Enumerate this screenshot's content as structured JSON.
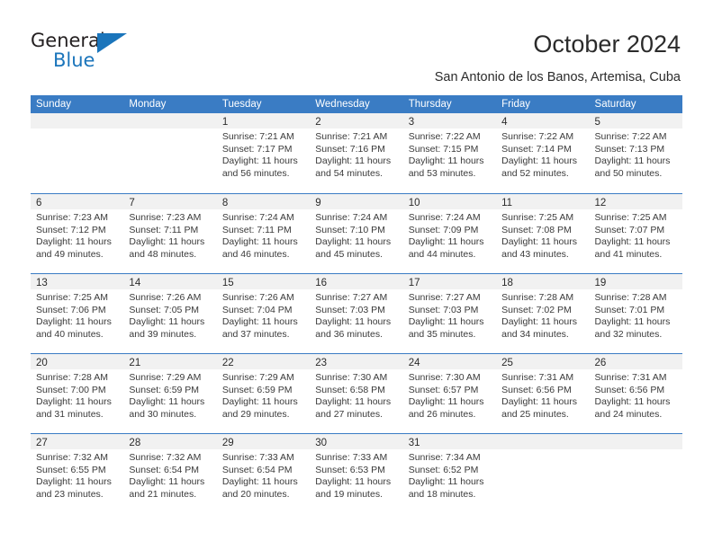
{
  "logo": {
    "line1": "General",
    "line2": "Blue",
    "triangle_color": "#1b75bb",
    "text_color": "#231f20"
  },
  "header": {
    "title": "October 2024",
    "subtitle": "San Antonio de los Banos, Artemisa, Cuba"
  },
  "colors": {
    "header_band": "#3a7cc4",
    "daynum_band": "#f1f1f1",
    "cell_background": "#ffffff",
    "text": "#3a3a3a"
  },
  "calendar": {
    "day_headers": [
      "Sunday",
      "Monday",
      "Tuesday",
      "Wednesday",
      "Thursday",
      "Friday",
      "Saturday"
    ],
    "weeks": [
      [
        {
          "day": "",
          "sunrise": "",
          "sunset": "",
          "daylight": "",
          "empty": true
        },
        {
          "day": "",
          "sunrise": "",
          "sunset": "",
          "daylight": "",
          "empty": true
        },
        {
          "day": "1",
          "sunrise": "Sunrise: 7:21 AM",
          "sunset": "Sunset: 7:17 PM",
          "daylight": "Daylight: 11 hours and 56 minutes.",
          "empty": false
        },
        {
          "day": "2",
          "sunrise": "Sunrise: 7:21 AM",
          "sunset": "Sunset: 7:16 PM",
          "daylight": "Daylight: 11 hours and 54 minutes.",
          "empty": false
        },
        {
          "day": "3",
          "sunrise": "Sunrise: 7:22 AM",
          "sunset": "Sunset: 7:15 PM",
          "daylight": "Daylight: 11 hours and 53 minutes.",
          "empty": false
        },
        {
          "day": "4",
          "sunrise": "Sunrise: 7:22 AM",
          "sunset": "Sunset: 7:14 PM",
          "daylight": "Daylight: 11 hours and 52 minutes.",
          "empty": false
        },
        {
          "day": "5",
          "sunrise": "Sunrise: 7:22 AM",
          "sunset": "Sunset: 7:13 PM",
          "daylight": "Daylight: 11 hours and 50 minutes.",
          "empty": false
        }
      ],
      [
        {
          "day": "6",
          "sunrise": "Sunrise: 7:23 AM",
          "sunset": "Sunset: 7:12 PM",
          "daylight": "Daylight: 11 hours and 49 minutes.",
          "empty": false
        },
        {
          "day": "7",
          "sunrise": "Sunrise: 7:23 AM",
          "sunset": "Sunset: 7:11 PM",
          "daylight": "Daylight: 11 hours and 48 minutes.",
          "empty": false
        },
        {
          "day": "8",
          "sunrise": "Sunrise: 7:24 AM",
          "sunset": "Sunset: 7:11 PM",
          "daylight": "Daylight: 11 hours and 46 minutes.",
          "empty": false
        },
        {
          "day": "9",
          "sunrise": "Sunrise: 7:24 AM",
          "sunset": "Sunset: 7:10 PM",
          "daylight": "Daylight: 11 hours and 45 minutes.",
          "empty": false
        },
        {
          "day": "10",
          "sunrise": "Sunrise: 7:24 AM",
          "sunset": "Sunset: 7:09 PM",
          "daylight": "Daylight: 11 hours and 44 minutes.",
          "empty": false
        },
        {
          "day": "11",
          "sunrise": "Sunrise: 7:25 AM",
          "sunset": "Sunset: 7:08 PM",
          "daylight": "Daylight: 11 hours and 43 minutes.",
          "empty": false
        },
        {
          "day": "12",
          "sunrise": "Sunrise: 7:25 AM",
          "sunset": "Sunset: 7:07 PM",
          "daylight": "Daylight: 11 hours and 41 minutes.",
          "empty": false
        }
      ],
      [
        {
          "day": "13",
          "sunrise": "Sunrise: 7:25 AM",
          "sunset": "Sunset: 7:06 PM",
          "daylight": "Daylight: 11 hours and 40 minutes.",
          "empty": false
        },
        {
          "day": "14",
          "sunrise": "Sunrise: 7:26 AM",
          "sunset": "Sunset: 7:05 PM",
          "daylight": "Daylight: 11 hours and 39 minutes.",
          "empty": false
        },
        {
          "day": "15",
          "sunrise": "Sunrise: 7:26 AM",
          "sunset": "Sunset: 7:04 PM",
          "daylight": "Daylight: 11 hours and 37 minutes.",
          "empty": false
        },
        {
          "day": "16",
          "sunrise": "Sunrise: 7:27 AM",
          "sunset": "Sunset: 7:03 PM",
          "daylight": "Daylight: 11 hours and 36 minutes.",
          "empty": false
        },
        {
          "day": "17",
          "sunrise": "Sunrise: 7:27 AM",
          "sunset": "Sunset: 7:03 PM",
          "daylight": "Daylight: 11 hours and 35 minutes.",
          "empty": false
        },
        {
          "day": "18",
          "sunrise": "Sunrise: 7:28 AM",
          "sunset": "Sunset: 7:02 PM",
          "daylight": "Daylight: 11 hours and 34 minutes.",
          "empty": false
        },
        {
          "day": "19",
          "sunrise": "Sunrise: 7:28 AM",
          "sunset": "Sunset: 7:01 PM",
          "daylight": "Daylight: 11 hours and 32 minutes.",
          "empty": false
        }
      ],
      [
        {
          "day": "20",
          "sunrise": "Sunrise: 7:28 AM",
          "sunset": "Sunset: 7:00 PM",
          "daylight": "Daylight: 11 hours and 31 minutes.",
          "empty": false
        },
        {
          "day": "21",
          "sunrise": "Sunrise: 7:29 AM",
          "sunset": "Sunset: 6:59 PM",
          "daylight": "Daylight: 11 hours and 30 minutes.",
          "empty": false
        },
        {
          "day": "22",
          "sunrise": "Sunrise: 7:29 AM",
          "sunset": "Sunset: 6:59 PM",
          "daylight": "Daylight: 11 hours and 29 minutes.",
          "empty": false
        },
        {
          "day": "23",
          "sunrise": "Sunrise: 7:30 AM",
          "sunset": "Sunset: 6:58 PM",
          "daylight": "Daylight: 11 hours and 27 minutes.",
          "empty": false
        },
        {
          "day": "24",
          "sunrise": "Sunrise: 7:30 AM",
          "sunset": "Sunset: 6:57 PM",
          "daylight": "Daylight: 11 hours and 26 minutes.",
          "empty": false
        },
        {
          "day": "25",
          "sunrise": "Sunrise: 7:31 AM",
          "sunset": "Sunset: 6:56 PM",
          "daylight": "Daylight: 11 hours and 25 minutes.",
          "empty": false
        },
        {
          "day": "26",
          "sunrise": "Sunrise: 7:31 AM",
          "sunset": "Sunset: 6:56 PM",
          "daylight": "Daylight: 11 hours and 24 minutes.",
          "empty": false
        }
      ],
      [
        {
          "day": "27",
          "sunrise": "Sunrise: 7:32 AM",
          "sunset": "Sunset: 6:55 PM",
          "daylight": "Daylight: 11 hours and 23 minutes.",
          "empty": false
        },
        {
          "day": "28",
          "sunrise": "Sunrise: 7:32 AM",
          "sunset": "Sunset: 6:54 PM",
          "daylight": "Daylight: 11 hours and 21 minutes.",
          "empty": false
        },
        {
          "day": "29",
          "sunrise": "Sunrise: 7:33 AM",
          "sunset": "Sunset: 6:54 PM",
          "daylight": "Daylight: 11 hours and 20 minutes.",
          "empty": false
        },
        {
          "day": "30",
          "sunrise": "Sunrise: 7:33 AM",
          "sunset": "Sunset: 6:53 PM",
          "daylight": "Daylight: 11 hours and 19 minutes.",
          "empty": false
        },
        {
          "day": "31",
          "sunrise": "Sunrise: 7:34 AM",
          "sunset": "Sunset: 6:52 PM",
          "daylight": "Daylight: 11 hours and 18 minutes.",
          "empty": false
        },
        {
          "day": "",
          "sunrise": "",
          "sunset": "",
          "daylight": "",
          "empty": true
        },
        {
          "day": "",
          "sunrise": "",
          "sunset": "",
          "daylight": "",
          "empty": true
        }
      ]
    ]
  }
}
